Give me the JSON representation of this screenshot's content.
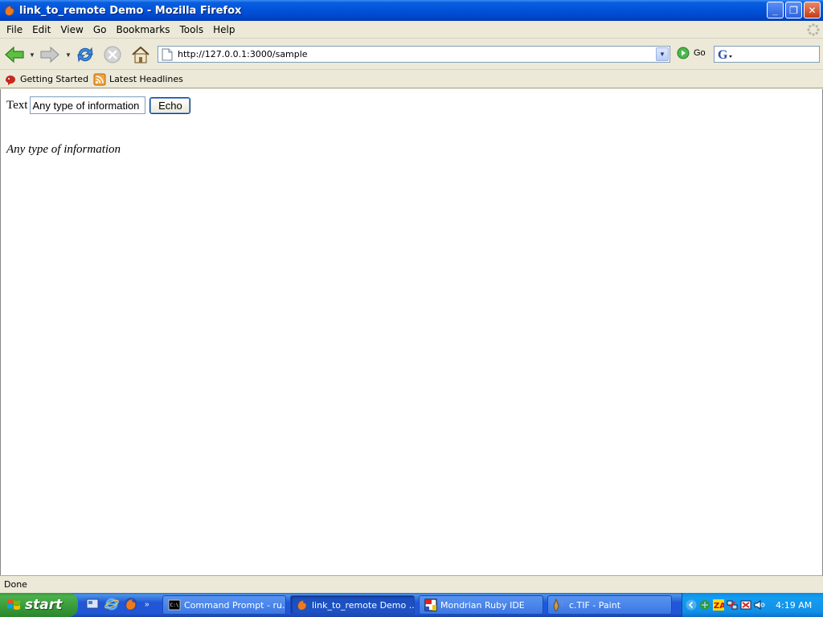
{
  "window": {
    "title": "link_to_remote Demo - Mozilla Firefox",
    "buttons": {
      "minimize": "_",
      "maximize": "❐",
      "close": "✕"
    }
  },
  "menu": [
    "File",
    "Edit",
    "View",
    "Go",
    "Bookmarks",
    "Tools",
    "Help"
  ],
  "navigation": {
    "url": "http://127.0.0.1:3000/sample",
    "go_label": "Go",
    "search_value": ""
  },
  "bookmarks": [
    "Getting Started",
    "Latest Headlines"
  ],
  "page": {
    "text_label": "Text",
    "input_value": "Any type of information",
    "echo_button": "Echo",
    "result_text": "Any type of information"
  },
  "status": {
    "text": "Done"
  },
  "taskbar": {
    "start_label": "start",
    "tasks": [
      {
        "label": "Command Prompt - ru...",
        "icon": "command-prompt-icon",
        "active": false
      },
      {
        "label": "link_to_remote Demo ...",
        "icon": "firefox-icon",
        "active": true
      },
      {
        "label": "Mondrian Ruby IDE",
        "icon": "mondrian-icon",
        "active": false
      },
      {
        "label": "c.TIF - Paint",
        "icon": "paint-icon",
        "active": false
      }
    ],
    "clock": "4:19 AM",
    "quicklaunch_more": "»"
  },
  "colors": {
    "titlebar": "#0052d9",
    "taskbar": "#2157d7",
    "start": "#379a37",
    "tray": "#118fe6",
    "chrome": "#ece9d8"
  }
}
